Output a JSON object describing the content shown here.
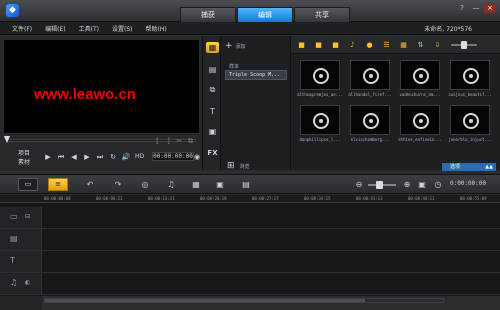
{
  "title_bar": {
    "mode_tabs": [
      {
        "label": "捕获",
        "active": false
      },
      {
        "label": "编辑",
        "active": true
      },
      {
        "label": "共享",
        "active": false
      }
    ],
    "window_controls": [
      "?",
      "—",
      "×"
    ]
  },
  "menu": {
    "items": [
      "文件(F)",
      "编辑(E)",
      "工具(T)",
      "设置(S)",
      "帮助(H)"
    ],
    "project_info": "未命名, 720*576"
  },
  "preview": {
    "watermark": "www.leawo.cn",
    "progress": 0.0,
    "mode_labels": [
      "项目",
      "素材"
    ],
    "timecode": "00:00:00:00",
    "hd_label": "HD",
    "transport_icons": [
      "play",
      "go-start",
      "prev-frame",
      "next-frame",
      "go-end",
      "repeat",
      "volume"
    ]
  },
  "library": {
    "add_label": "添加",
    "folder_caption": "样本",
    "selected_folder": "Triple Scoop M...",
    "browse_label": "浏览",
    "options_label": "选项",
    "thumbnails": [
      "altheapremjes_ae...",
      "allhandel_firef...",
      "vadenchurns_am...",
      "cuijnus_beautif...",
      "danphillipse_l...",
      "elvischomberg...",
      "ethies_eofinein...",
      "jonorblo_injust..."
    ]
  },
  "timeline": {
    "ruler_marks": [
      "00:00:00:00",
      "00:00:06:23",
      "00:00:13:21",
      "00:00:20:19",
      "00:00:27:17",
      "00:00:34:15",
      "00:00:41:13",
      "00:00:48:11",
      "00:00:55:09"
    ],
    "timecode": "0:00:00:00",
    "zoom_level": 0.35
  }
}
